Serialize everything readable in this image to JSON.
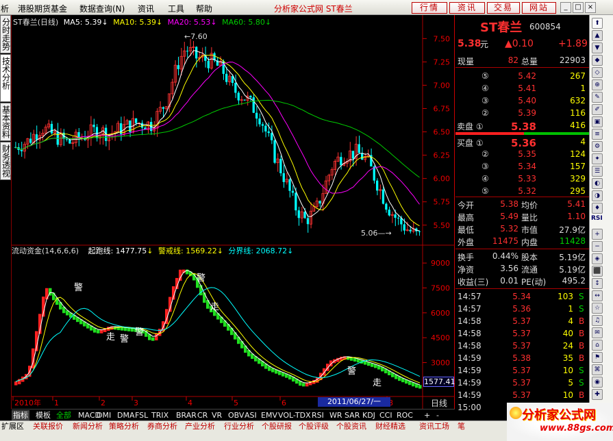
{
  "menu": {
    "items": [
      "析",
      "港股期货基金",
      "数据查询(N)",
      "资讯",
      "工具",
      "帮助"
    ],
    "title": "分析家公式网 ST春兰"
  },
  "top_buttons": [
    "行情",
    "资讯",
    "交易",
    "网站"
  ],
  "window_buttons": [
    "_",
    "□",
    "×"
  ],
  "side_tabs": [
    "分时走势",
    "技术分析",
    "基本资料",
    "财务透视"
  ],
  "main_chart": {
    "legend": {
      "name": "ST春兰(日线)",
      "ma5": "MA5: 5.39",
      "ma10": "MA10: 5.39",
      "ma20": "MA20: 5.53",
      "ma60": "MA60: 5.80"
    },
    "y_ticks": [
      "7.50",
      "7.25",
      "7.00",
      "6.75",
      "6.50",
      "6.25",
      "6.00",
      "5.75",
      "5.50"
    ],
    "high_label": "7.60",
    "low_label": "5.06",
    "ylim": [
      5.3,
      7.62
    ],
    "colors": {
      "up": "#ff3333",
      "down": "#00ffff",
      "ma5": "#ffffff",
      "ma10": "#ffff00",
      "ma20": "#ff00ff",
      "ma60": "#00cc00"
    }
  },
  "sub_chart": {
    "legend": {
      "name": "流动资金(14,6,6,6)",
      "qipao": "起跑线: 1477.75",
      "jingjie": "警戒线: 1569.22",
      "fenjie": "分界线: 2068.72"
    },
    "y_ticks": [
      "9000",
      "7500",
      "6000",
      "4500",
      "3000"
    ],
    "current_value": "1577.41",
    "warn_label": "警",
    "walk_label": "走"
  },
  "x_axis": {
    "labels": [
      "2010年",
      "1",
      "2",
      "3",
      "4",
      "5",
      "6",
      "8"
    ],
    "cursor_date": "2011/06/27/一",
    "period": "日线"
  },
  "quote": {
    "name": "ST春兰",
    "code": "600854",
    "price": "5.38",
    "price_unit": "元",
    "change": "▲0.10",
    "pct": "+1.89",
    "xianliang_label": "现量",
    "xianliang": "82",
    "zongliang_label": "总量",
    "zongliang": "22903",
    "sells": [
      {
        "lvl": "⑤",
        "price": "5.42",
        "vol": "267"
      },
      {
        "lvl": "④",
        "price": "5.41",
        "vol": "1"
      },
      {
        "lvl": "③",
        "price": "5.40",
        "vol": "632"
      },
      {
        "lvl": "②",
        "price": "5.39",
        "vol": "116"
      },
      {
        "lvl": "卖盘 ①",
        "price": "5.38",
        "vol": "416"
      }
    ],
    "buys": [
      {
        "lvl": "买盘 ①",
        "price": "5.36",
        "vol": "4"
      },
      {
        "lvl": "②",
        "price": "5.35",
        "vol": "124"
      },
      {
        "lvl": "③",
        "price": "5.34",
        "vol": "157"
      },
      {
        "lvl": "④",
        "price": "5.33",
        "vol": "329"
      },
      {
        "lvl": "⑤",
        "price": "5.32",
        "vol": "295"
      }
    ],
    "stats": [
      {
        "l1": "今开",
        "v1": "5.38",
        "l2": "均价",
        "v2": "5.41"
      },
      {
        "l1": "最高",
        "v1": "5.49",
        "l2": "量比",
        "v2": "1.10"
      },
      {
        "l1": "最低",
        "v1": "5.32",
        "l2": "市值",
        "v2": "27.9亿"
      },
      {
        "l1": "外盘",
        "v1": "11475",
        "l2": "内盘",
        "v2": "11428"
      },
      {
        "l1": "换手",
        "v1": "0.44%",
        "l2": "股本",
        "v2": "5.19亿"
      },
      {
        "l1": "净资",
        "v1": "3.56",
        "l2": "流通",
        "v2": "5.19亿"
      },
      {
        "l1": "收益(三)",
        "v1": "0.01",
        "l2": "PE(动)",
        "v2": "495.2"
      }
    ],
    "ticks": [
      {
        "t": "14:57",
        "p": "5.34",
        "v": "103",
        "s": "S"
      },
      {
        "t": "14:57",
        "p": "5.36",
        "v": "1",
        "s": "S"
      },
      {
        "t": "14:58",
        "p": "5.37",
        "v": "4",
        "s": "B"
      },
      {
        "t": "14:58",
        "p": "5.37",
        "v": "40",
        "s": "B"
      },
      {
        "t": "14:58",
        "p": "5.37",
        "v": "24",
        "s": "B"
      },
      {
        "t": "14:59",
        "p": "5.38",
        "v": "35",
        "s": "B"
      },
      {
        "t": "14:59",
        "p": "5.37",
        "v": "10",
        "s": "S"
      },
      {
        "t": "14:59",
        "p": "5.37",
        "v": "5",
        "s": "S"
      },
      {
        "t": "14:59",
        "p": "5.37",
        "v": "10",
        "s": "B"
      },
      {
        "t": "15:00",
        "p": "",
        "v": "",
        "s": ""
      }
    ]
  },
  "right_strip": [
    "RSI"
  ],
  "bottom_tabs": [
    "指标",
    "模板",
    "全部",
    "MACD",
    "DMI",
    "DMA",
    "FSL",
    "TRIX",
    "BRAR",
    "CR",
    "VR",
    "OBV",
    "ASI",
    "EMV",
    "VOL-TDX",
    "RSI",
    "WR",
    "SAR",
    "KDJ",
    "CCI",
    "ROC",
    "+",
    "-"
  ],
  "status_tabs": [
    "扩展区",
    "关联报价",
    "新闻分析",
    "策略分析",
    "券商分析",
    "产业分析",
    "行业分析",
    "个股研报",
    "个股评级",
    "个股资讯",
    "财经精选",
    "资讯工场",
    "笔"
  ],
  "logo": {
    "text": "分析家公式网",
    "url": "www.88gs.com"
  }
}
